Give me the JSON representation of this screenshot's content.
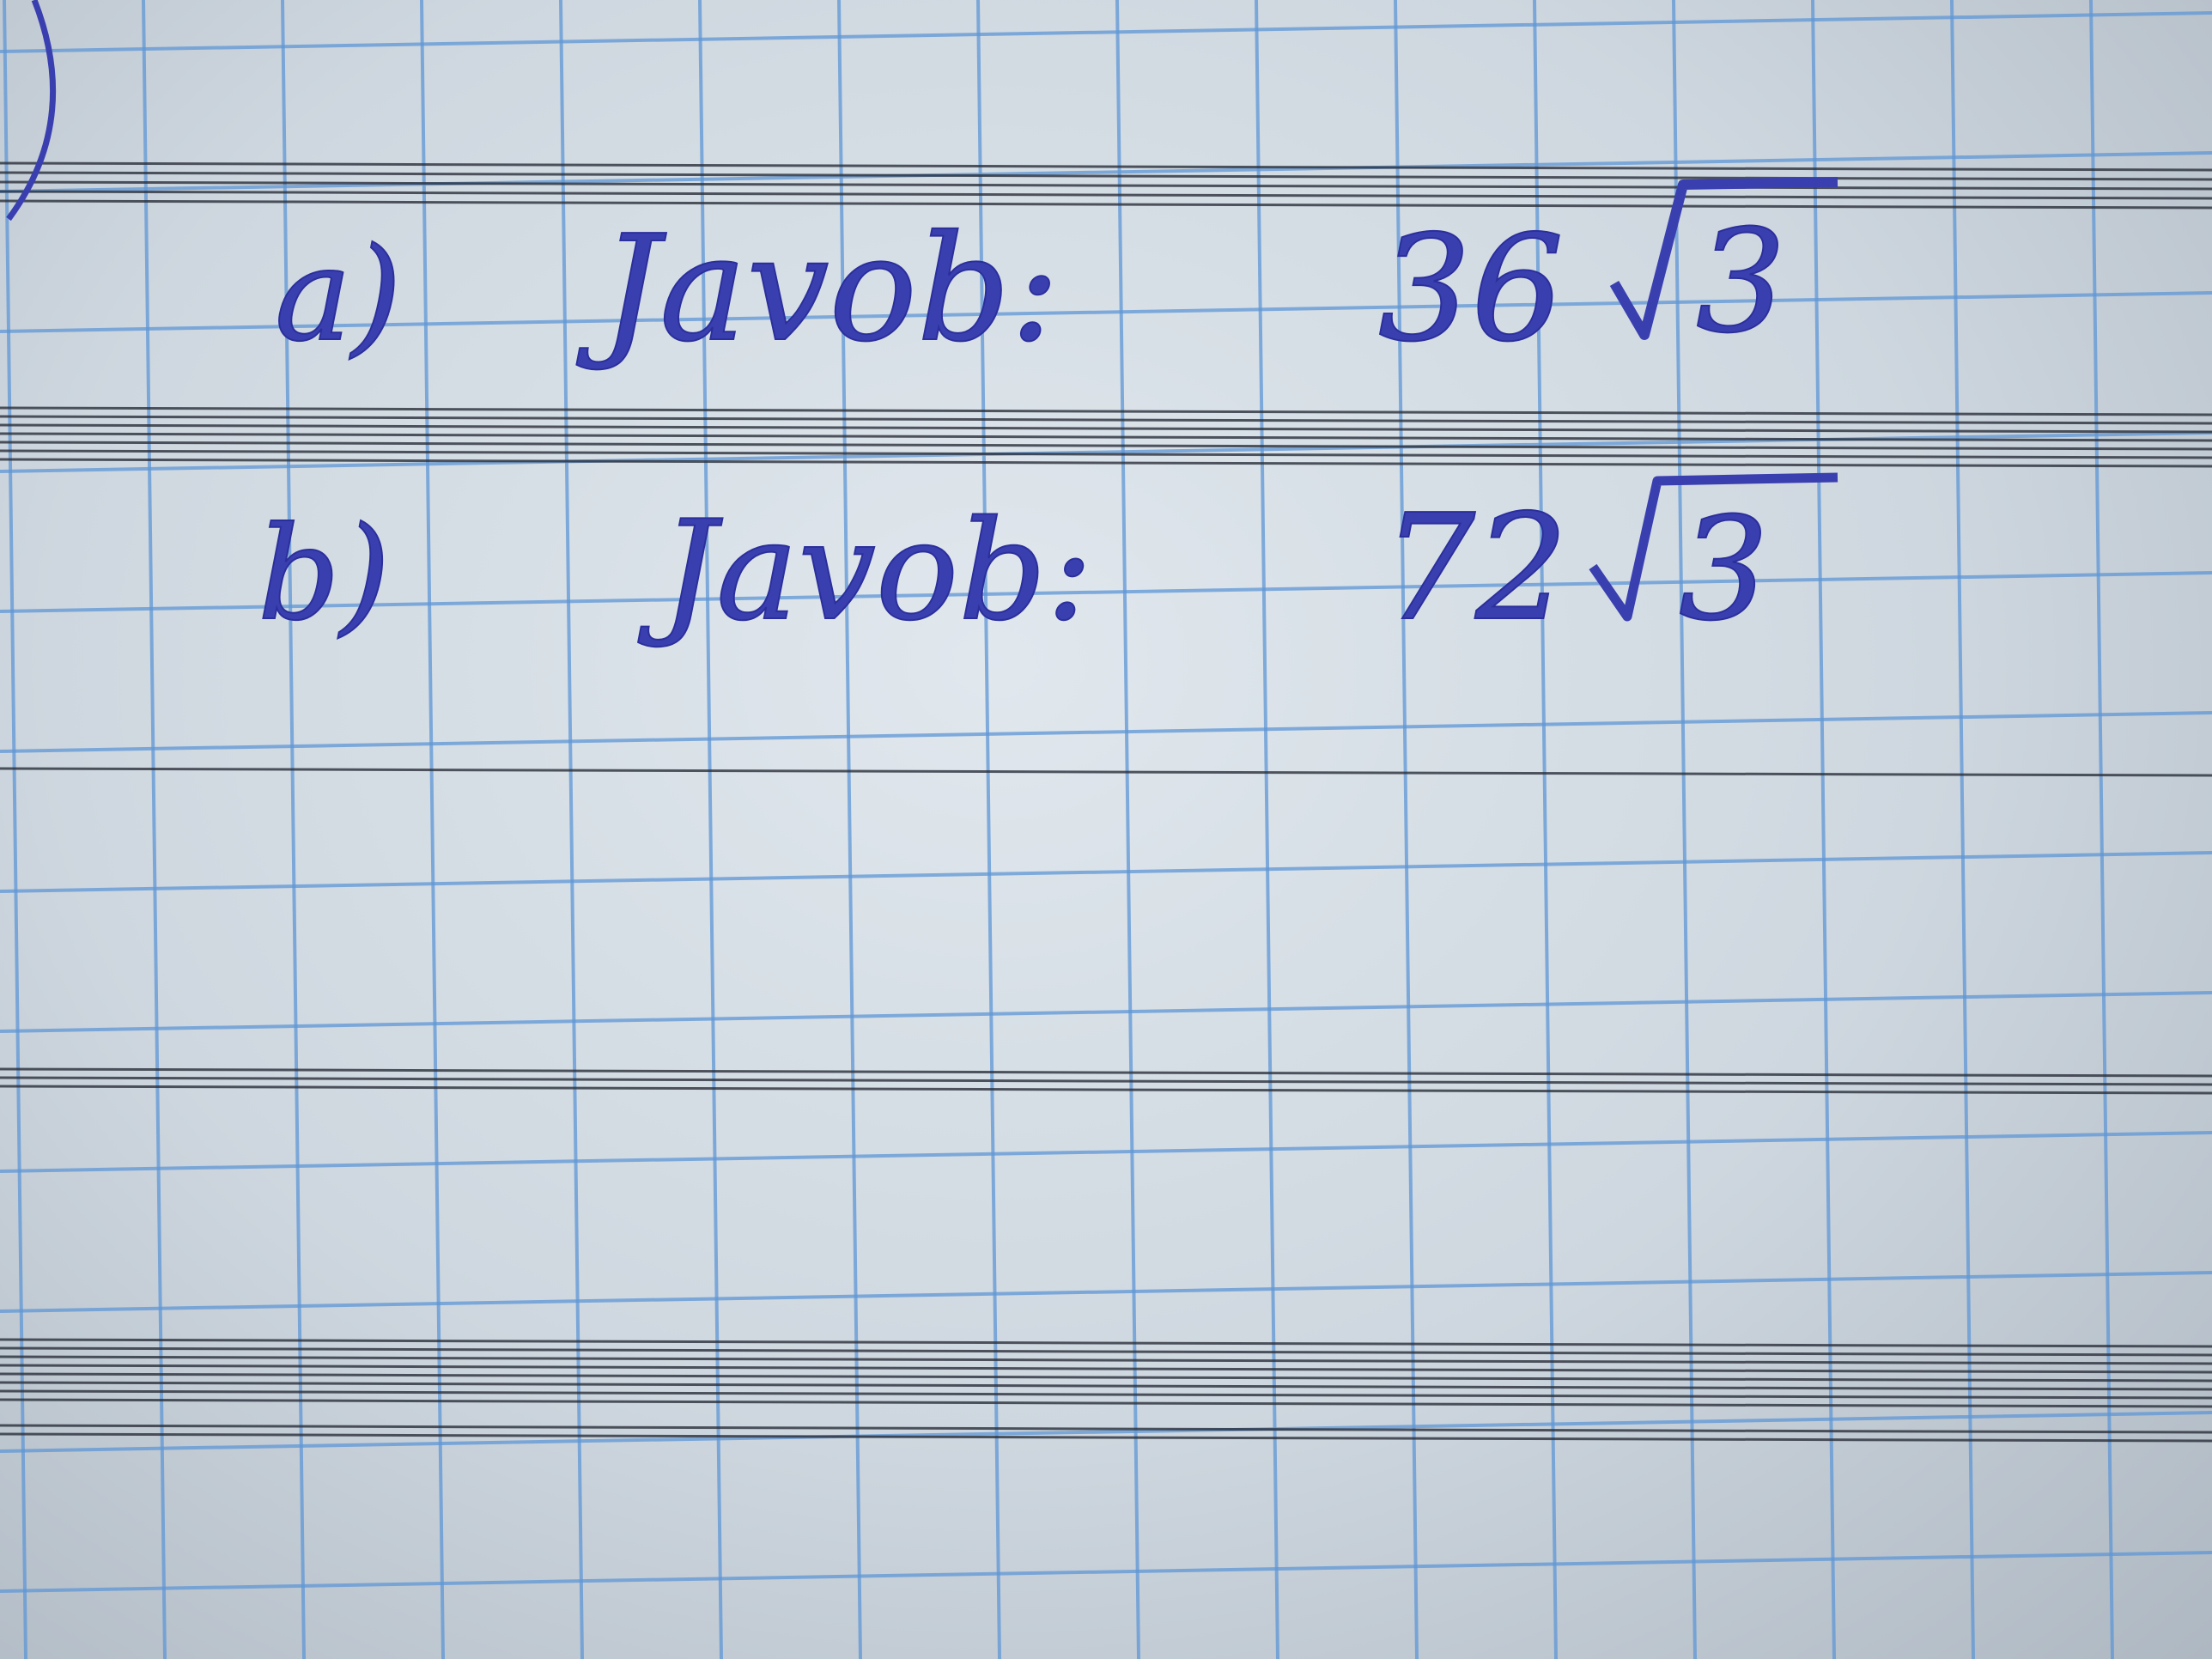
{
  "paper": {
    "background": "#d4dce4",
    "grid_color": "#5f97d6",
    "rule_color": "#2a2f3a",
    "ink_color": "#3a3fb0"
  },
  "lines": [
    {
      "label": "a)",
      "word": "Javob:",
      "answer_num": "36",
      "answer_root": "3"
    },
    {
      "label": "b)",
      "word": "Javob:",
      "answer_num": "72",
      "answer_root": "3"
    }
  ]
}
